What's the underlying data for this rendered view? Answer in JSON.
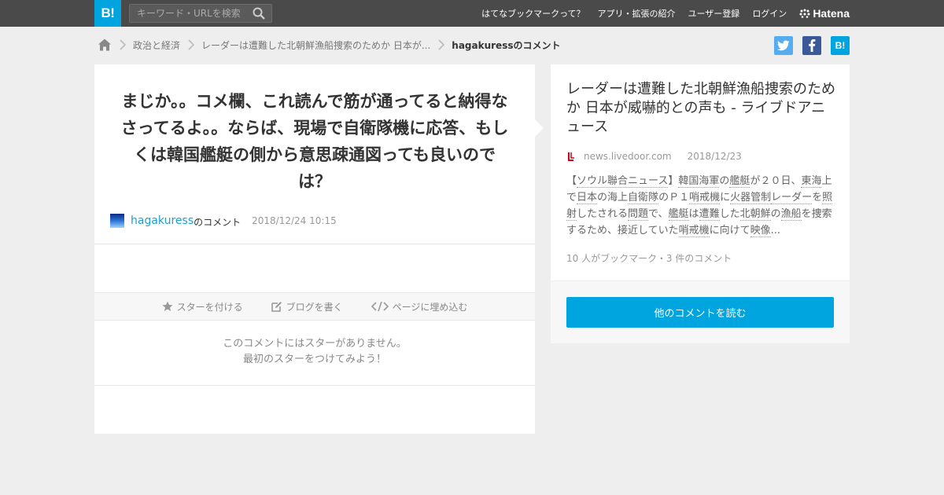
{
  "header": {
    "logo": "B!",
    "search_placeholder": "キーワード・URLを検索",
    "nav": [
      "はてなブックマークって？",
      "アプリ・拡張の紹介",
      "ユーザー登録",
      "ログイン"
    ],
    "brand": "Hatena"
  },
  "breadcrumb": {
    "items": [
      "政治と経済",
      "レーダーは遭難した北朝鮮漁船捜索のためか 日本が..."
    ],
    "current": "hagakuressのコメント"
  },
  "comment": {
    "text": "まじか。。コメ欄、これ読んで筋が通ってると納得なさってるよ。。ならば、現場で自衛隊機に応答、もしくは韓国艦艇の側から意思疎通図っても良いのでは？",
    "author": "hagakuress",
    "author_suffix": "のコメント",
    "date": "2018/12/24 10:15"
  },
  "actions": {
    "star": "スターを付ける",
    "blog": "ブログを書く",
    "embed": "ページに埋め込む"
  },
  "stars_empty": {
    "line1": "このコメントにはスターがありません。",
    "line2": "最初のスターをつけてみよう！"
  },
  "entry": {
    "title": "レーダーは遭難した北朝鮮漁船捜索のためか 日本が威嚇的との声も - ライブドアニュース",
    "domain": "news.livedoor.com",
    "date": "2018/12/23",
    "summary_parts": [
      {
        "t": "【"
      },
      {
        "t": "ソウル聯合ニュース",
        "link": true
      },
      {
        "t": "】"
      },
      {
        "t": "韓国海軍",
        "link": true
      },
      {
        "t": "の"
      },
      {
        "t": "艦艇",
        "link": true
      },
      {
        "t": "が２０日、"
      },
      {
        "t": "東海",
        "link": true
      },
      {
        "t": "上で"
      },
      {
        "t": "日本",
        "link": true
      },
      {
        "t": "の海上"
      },
      {
        "t": "自衛隊",
        "link": true
      },
      {
        "t": "のＰ１"
      },
      {
        "t": "哨戒機",
        "link": true
      },
      {
        "t": "に"
      },
      {
        "t": "火器管制",
        "link": true
      },
      {
        "t": "レーダー",
        "link": true
      },
      {
        "t": "を"
      },
      {
        "t": "照射",
        "link": true
      },
      {
        "t": "したされる"
      },
      {
        "t": "問題",
        "link": true
      },
      {
        "t": "で、"
      },
      {
        "t": "艦艇",
        "link": true
      },
      {
        "t": "は"
      },
      {
        "t": "遭難",
        "link": true
      },
      {
        "t": "した"
      },
      {
        "t": "北朝鮮",
        "link": true
      },
      {
        "t": "の"
      },
      {
        "t": "漁船",
        "link": true
      },
      {
        "t": "を捜索するため、接近していた"
      },
      {
        "t": "哨戒機",
        "link": true
      },
      {
        "t": "に向けて"
      },
      {
        "t": "映像",
        "link": true
      },
      {
        "t": "..."
      }
    ],
    "counts": "10 人がブックマーク・3 件のコメント",
    "read_button": "他のコメントを読む"
  },
  "colors": {
    "brand_blue": "#00a4de",
    "topbar": "#4a4a4a",
    "twitter": "#55acee",
    "facebook": "#3b5998"
  }
}
